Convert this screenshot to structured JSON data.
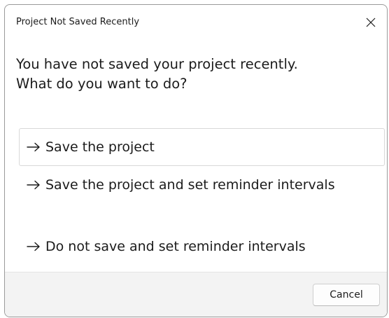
{
  "window": {
    "title": "Project Not Saved Recently",
    "close_icon": "close-icon"
  },
  "message": {
    "line1": "You have not saved your project recently.",
    "line2": "What do you want to do?"
  },
  "options": [
    {
      "icon": "arrow-right-icon",
      "label": "Save the project",
      "focused": true
    },
    {
      "icon": "arrow-right-icon",
      "label": "Save the project and set reminder intervals",
      "focused": false
    },
    {
      "icon": "arrow-right-icon",
      "label": "Do not save and set reminder intervals",
      "focused": false
    }
  ],
  "footer": {
    "cancel_label": "Cancel"
  },
  "colors": {
    "text": "#1b1b1b",
    "footer_background": "#f3f3f3",
    "focus_border": "#d8d8d8"
  }
}
